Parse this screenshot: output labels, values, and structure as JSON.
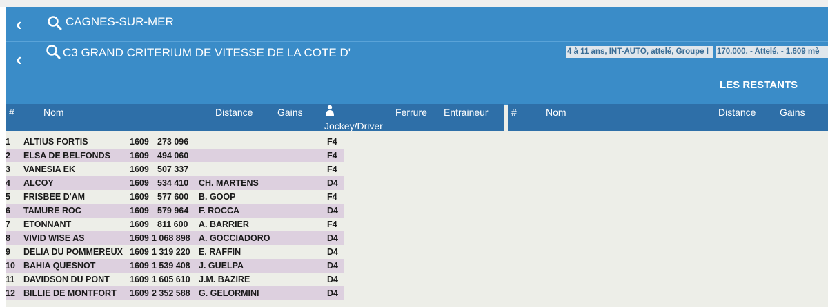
{
  "hippodrome": "CAGNES-SUR-MER",
  "course": {
    "title": "C3 GRAND CRITERIUM DE VITESSE DE LA COTE D'",
    "conditions": "4 à 11 ans, INT-AUTO, attelé, Groupe I",
    "prize": "170.000. - Attelé. - 1.609 mè"
  },
  "section_title": "LES RESTANTS",
  "left_table": {
    "headers": {
      "num": "#",
      "nom": "Nom",
      "distance": "Distance",
      "gains": "Gains",
      "jockey": "Jockey/Driver",
      "ferrure": "Ferrure",
      "entraineur": "Entraineur"
    },
    "rows": [
      {
        "num": "1",
        "nom": "ALTIUS FORTIS",
        "distance": "1609",
        "gains": "273 096",
        "driver": "",
        "ferrure": "F4"
      },
      {
        "num": "2",
        "nom": "ELSA DE BELFONDS",
        "distance": "1609",
        "gains": "494 060",
        "driver": "",
        "ferrure": "F4"
      },
      {
        "num": "3",
        "nom": "VANESIA EK",
        "distance": "1609",
        "gains": "507 337",
        "driver": "",
        "ferrure": "F4"
      },
      {
        "num": "4",
        "nom": "ALCOY",
        "distance": "1609",
        "gains": "534 410",
        "driver": "CH. MARTENS",
        "ferrure": "D4"
      },
      {
        "num": "5",
        "nom": "FRISBEE D'AM",
        "distance": "1609",
        "gains": "577 600",
        "driver": "B. GOOP",
        "ferrure": "F4"
      },
      {
        "num": "6",
        "nom": "TAMURE ROC",
        "distance": "1609",
        "gains": "579 964",
        "driver": "F. ROCCA",
        "ferrure": "D4"
      },
      {
        "num": "7",
        "nom": "ETONNANT",
        "distance": "1609",
        "gains": "811 600",
        "driver": "A. BARRIER",
        "ferrure": "F4"
      },
      {
        "num": "8",
        "nom": "VIVID WISE AS",
        "distance": "1609",
        "gains": "1 068 898",
        "driver": "A. GOCCIADORO",
        "ferrure": "D4"
      },
      {
        "num": "9",
        "nom": "DELIA DU POMMEREUX",
        "distance": "1609",
        "gains": "1 319 220",
        "driver": "E. RAFFIN",
        "ferrure": "D4"
      },
      {
        "num": "10",
        "nom": "BAHIA QUESNOT",
        "distance": "1609",
        "gains": "1 539 408",
        "driver": "J. GUELPA",
        "ferrure": "D4"
      },
      {
        "num": "11",
        "nom": "DAVIDSON DU PONT",
        "distance": "1609",
        "gains": "1 605 610",
        "driver": "J.M. BAZIRE",
        "ferrure": "D4"
      },
      {
        "num": "12",
        "nom": "BILLIE DE MONTFORT",
        "distance": "1609",
        "gains": "2 352 588",
        "driver": "G. GELORMINI",
        "ferrure": "D4"
      }
    ]
  },
  "right_table": {
    "headers": {
      "num": "#",
      "nom": "Nom",
      "distance": "Distance",
      "gains": "Gains"
    }
  },
  "colors": {
    "header_blue": "#3a8cc8",
    "table_header": "#2e6fa8",
    "row_alt": "#ddd0df",
    "panel_bg": "#edeee8"
  }
}
